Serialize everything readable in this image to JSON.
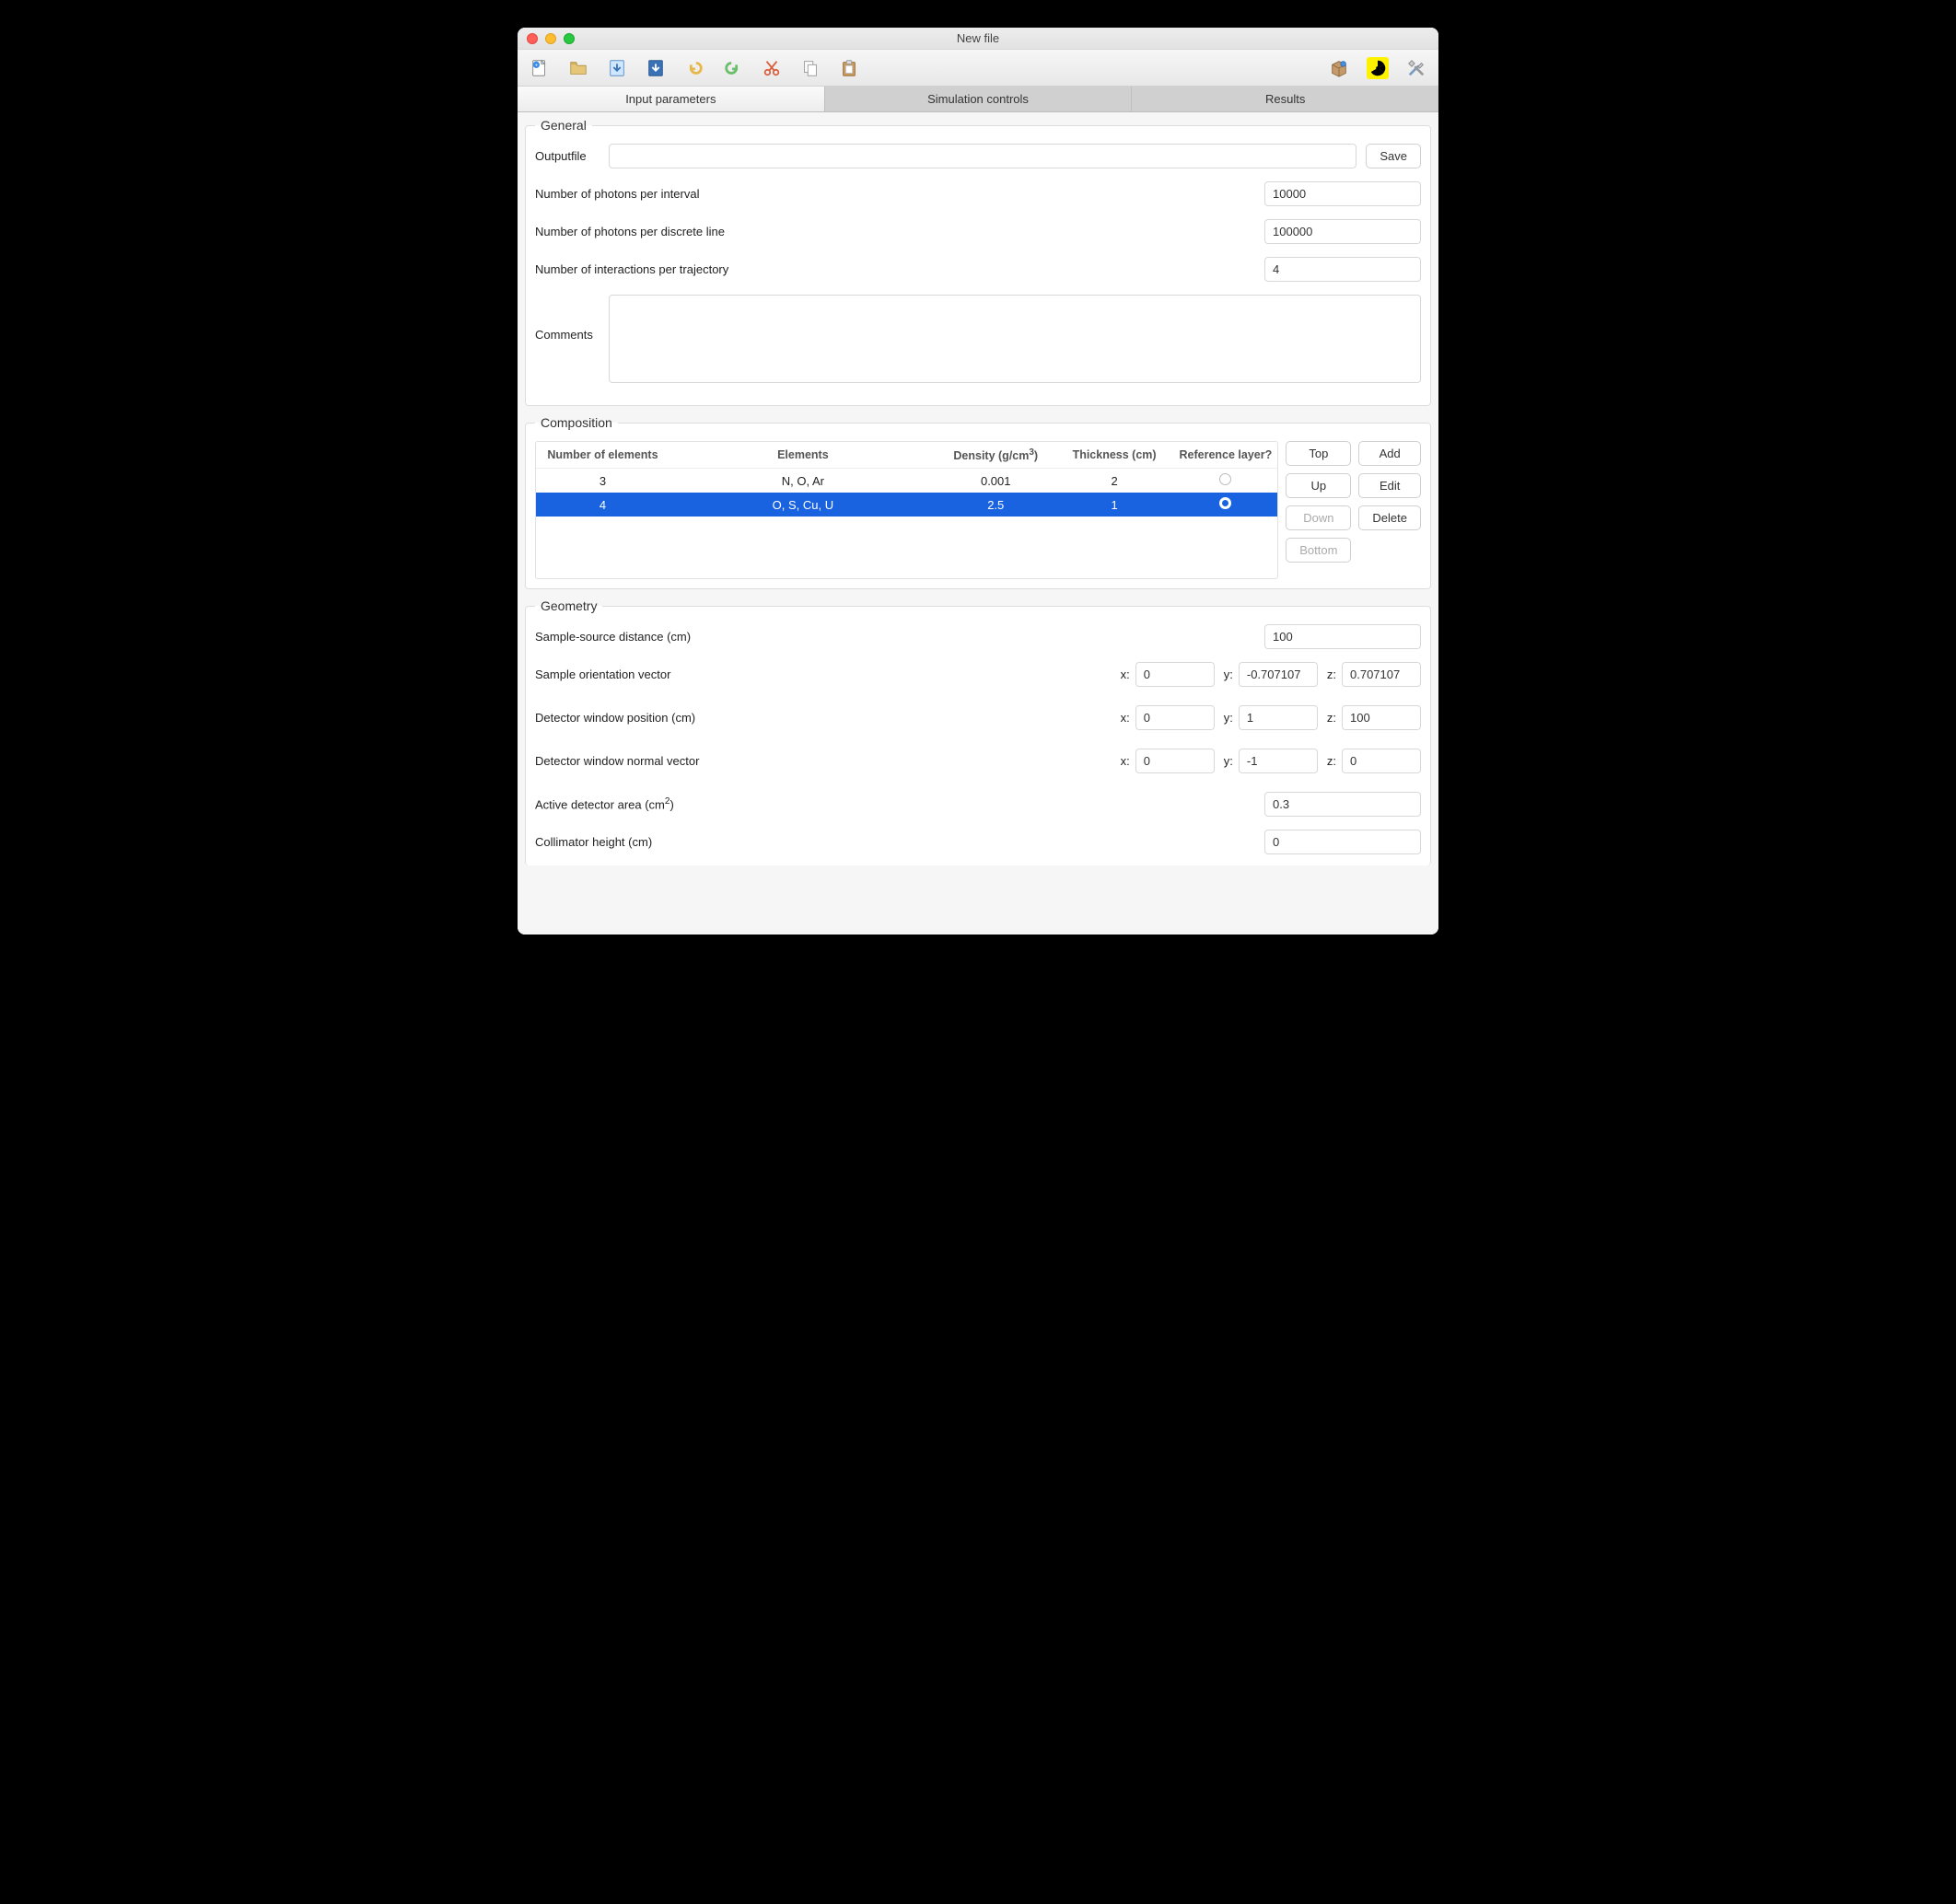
{
  "window": {
    "title": "New file"
  },
  "toolbar_icons": {
    "new": "new-file-icon",
    "open": "open-folder-icon",
    "save": "save-icon",
    "save_as": "save-as-icon",
    "undo": "undo-icon",
    "redo": "redo-icon",
    "cut": "cut-icon",
    "copy": "copy-icon",
    "paste": "paste-icon",
    "pkg": "package-icon",
    "rad": "radiation-icon",
    "prefs": "tools-icon"
  },
  "tabs": {
    "input": "Input parameters",
    "sim": "Simulation controls",
    "results": "Results",
    "active": "input"
  },
  "general": {
    "legend": "General",
    "outputfile_label": "Outputfile",
    "outputfile_value": "",
    "save_label": "Save",
    "photons_interval_label": "Number of photons per interval",
    "photons_interval_value": "10000",
    "photons_line_label": "Number of photons per discrete line",
    "photons_line_value": "100000",
    "interactions_label": "Number of interactions per trajectory",
    "interactions_value": "4",
    "comments_label": "Comments",
    "comments_value": ""
  },
  "composition": {
    "legend": "Composition",
    "headers": {
      "num": "Number of elements",
      "elems": "Elements",
      "density": "Density (g/cm",
      "density_sup": "3",
      "density_close": ")",
      "thickness": "Thickness (cm)",
      "ref": "Reference layer?"
    },
    "rows": [
      {
        "num": "3",
        "elems": "N, O, Ar",
        "density": "0.001",
        "thickness": "2",
        "ref": false,
        "selected": false
      },
      {
        "num": "4",
        "elems": "O, S, Cu, U",
        "density": "2.5",
        "thickness": "1",
        "ref": true,
        "selected": true
      }
    ],
    "btn_top": "Top",
    "btn_up": "Up",
    "btn_down": "Down",
    "btn_bottom": "Bottom",
    "btn_add": "Add",
    "btn_edit": "Edit",
    "btn_delete": "Delete"
  },
  "geometry": {
    "legend": "Geometry",
    "sample_source_label": "Sample-source distance (cm)",
    "sample_source_value": "100",
    "sample_orient_label": "Sample orientation vector",
    "sample_orient": {
      "x": "0",
      "y": "-0.707107",
      "z": "0.707107"
    },
    "det_pos_label": "Detector window position (cm)",
    "det_pos": {
      "x": "0",
      "y": "1",
      "z": "100"
    },
    "det_norm_label": "Detector window normal vector",
    "det_norm": {
      "x": "0",
      "y": "-1",
      "z": "0"
    },
    "active_area_label_pre": "Active detector area (cm",
    "active_area_label_sup": "2",
    "active_area_label_post": ")",
    "active_area_value": "0.3",
    "collimator_label": "Collimator height (cm)",
    "collimator_value": "0",
    "axis": {
      "x": "x:",
      "y": "y:",
      "z": "z:"
    }
  }
}
